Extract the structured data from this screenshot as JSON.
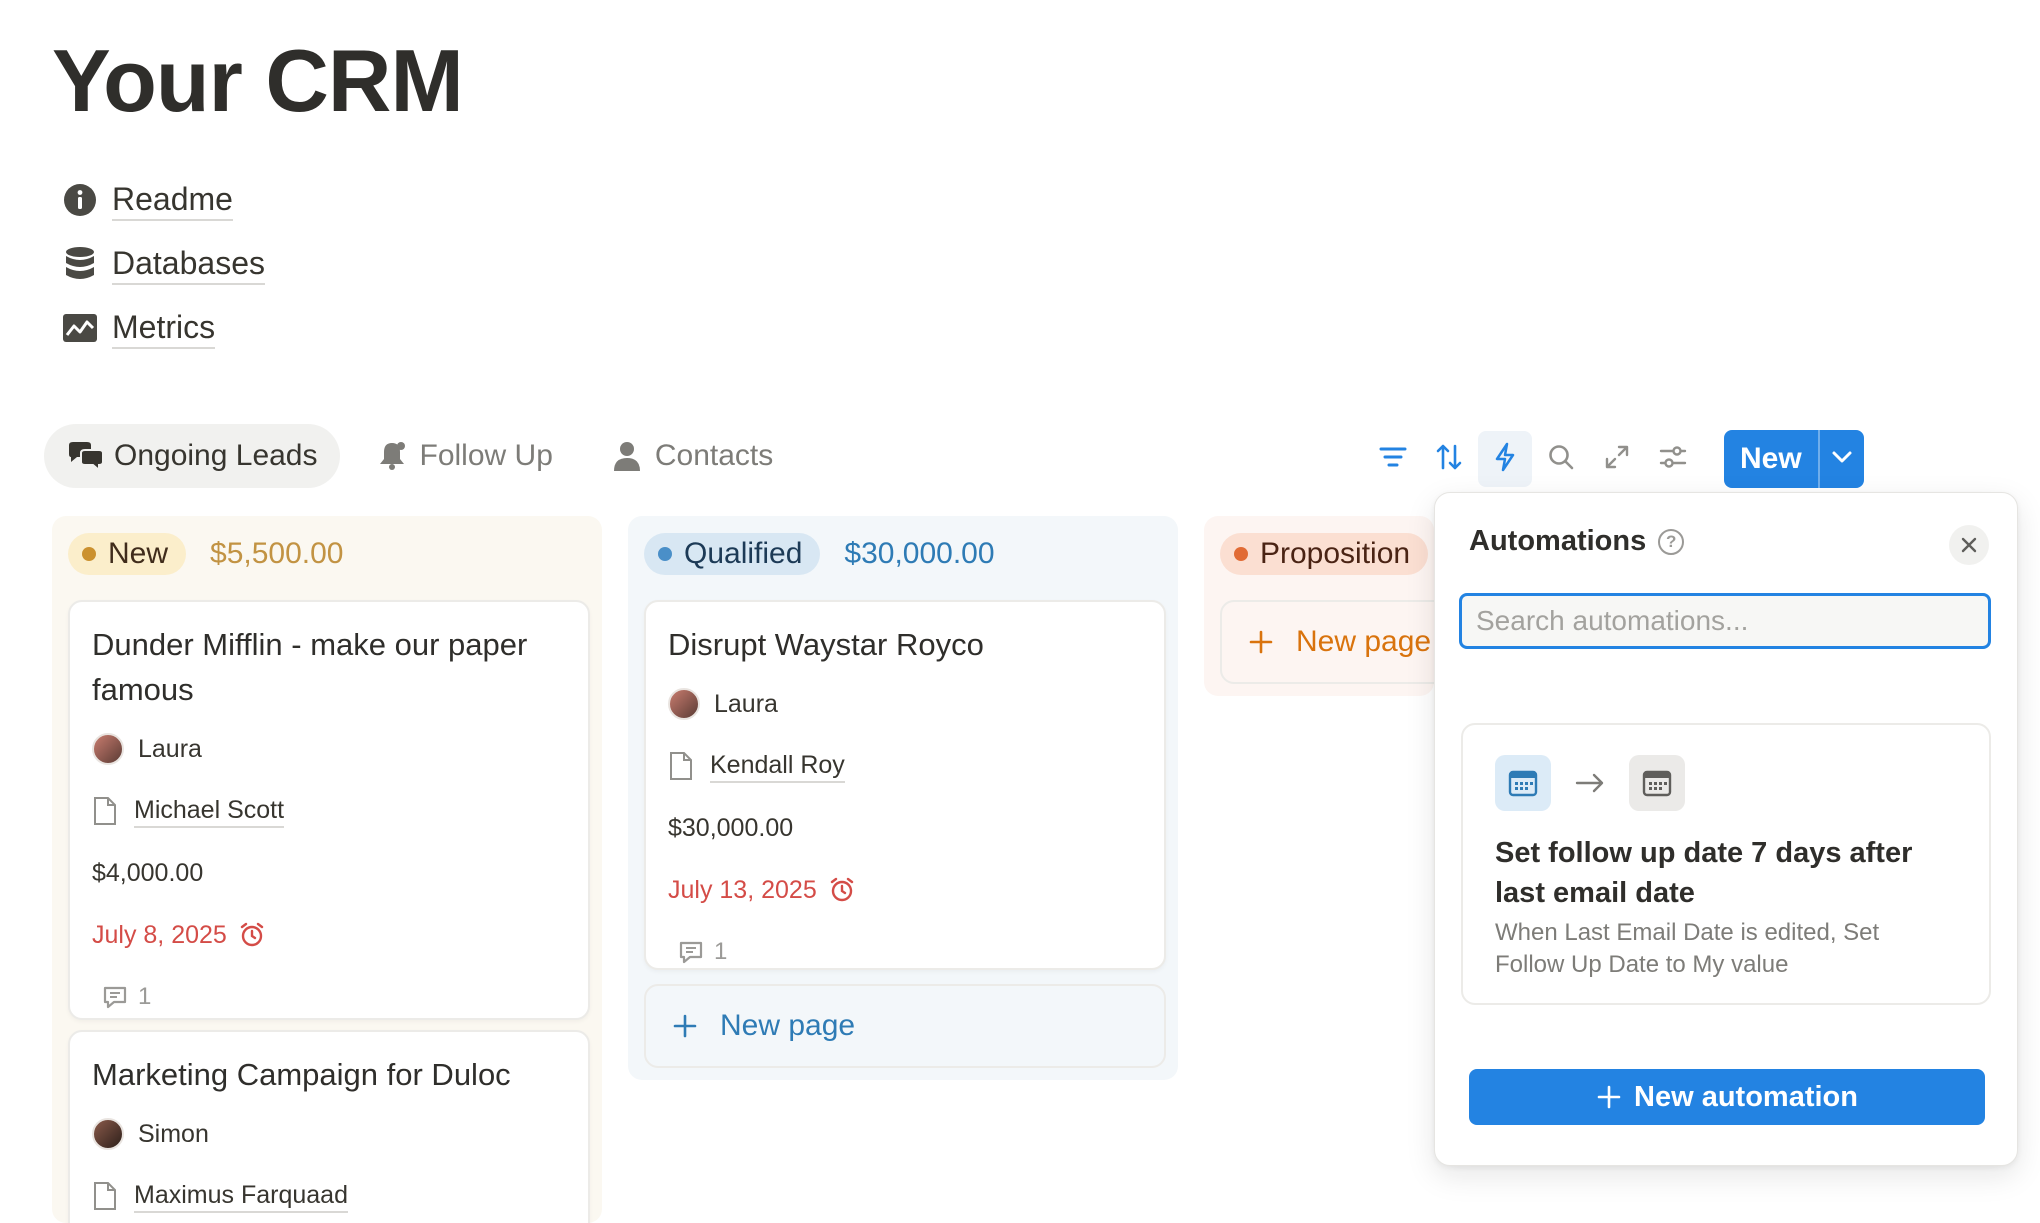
{
  "page": {
    "title": "Your CRM"
  },
  "links": [
    {
      "label": "Readme",
      "icon": "info-icon"
    },
    {
      "label": "Databases",
      "icon": "database-icon"
    },
    {
      "label": "Metrics",
      "icon": "chart-icon"
    }
  ],
  "tabs": [
    {
      "label": "Ongoing Leads",
      "icon": "chat-bubbles-icon",
      "active": true
    },
    {
      "label": "Follow Up",
      "icon": "bell-icon",
      "active": false
    },
    {
      "label": "Contacts",
      "icon": "person-icon",
      "active": false
    }
  ],
  "toolbar": {
    "new_label": "New",
    "icons": [
      "filter-icon",
      "sort-icon",
      "lightning-icon",
      "search-icon",
      "expand-icon",
      "settings-sliders-icon"
    ],
    "accent": "#2383e2"
  },
  "columns": [
    {
      "status": "New",
      "sum": "$5,500.00",
      "dot_color": "#cb912f",
      "pill_bg": "#fbeecb",
      "pill_text": "#402c1b",
      "sum_color": "#c29343",
      "cards": [
        {
          "title": "Dunder Mifflin - make our paper famous",
          "owner": "Laura",
          "contact": "Michael Scott",
          "amount": "$4,000.00",
          "date": "July 8, 2025",
          "comments": "1"
        },
        {
          "title": "Marketing Campaign for Duloc",
          "owner": "Simon",
          "contact": "Maximus Farquaad"
        }
      ]
    },
    {
      "status": "Qualified",
      "sum": "$30,000.00",
      "dot_color": "#4a8fc8",
      "pill_bg": "#d8e7f3",
      "pill_text": "#1c3a56",
      "sum_color": "#2e7bb5",
      "cards": [
        {
          "title": "Disrupt Waystar Royco",
          "owner": "Laura",
          "contact": "Kendall Roy",
          "amount": "$30,000.00",
          "date": "July 13, 2025",
          "comments": "1"
        }
      ],
      "new_page": "New page"
    },
    {
      "status": "Proposition",
      "dot_color": "#e16b35",
      "pill_bg": "#fbdfd2",
      "pill_text": "#4a2314",
      "new_page": "New page"
    }
  ],
  "automations": {
    "title": "Automations",
    "search_placeholder": "Search automations...",
    "item": {
      "title": "Set follow up date 7 days after last email date",
      "description": "When Last Email Date is edited, Set Follow Up Date to My value"
    },
    "new_button": "New automation"
  }
}
